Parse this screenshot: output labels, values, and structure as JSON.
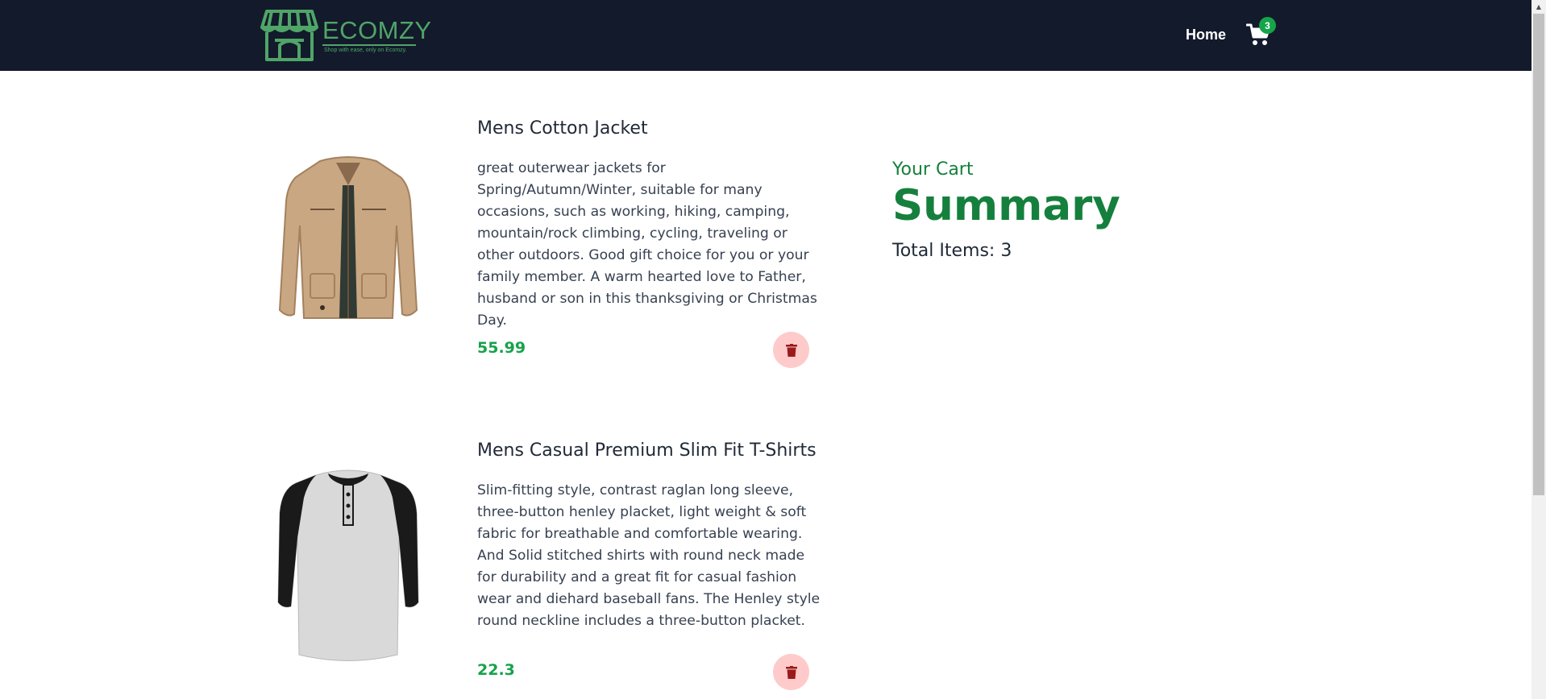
{
  "navbar": {
    "brand_name": "ECOMZY",
    "brand_tagline": "Shop with ease, only on Ecomzy.",
    "home_label": "Home",
    "cart_count": "3",
    "colors": {
      "background": "#131a2b",
      "brand": "#4fa568",
      "badge": "#16a34a"
    }
  },
  "items": [
    {
      "title": "Mens Cotton Jacket",
      "description": "great outerwear jackets for Spring/Autumn/Winter, suitable for many occasions, such as working, hiking, camping, mountain/rock climbing, cycling, traveling or other outdoors. Good gift choice for you or your family member. A warm hearted love to Father, husband or son in this thanksgiving or Christmas Day.",
      "price": "55.99",
      "image_icon": "jacket-image",
      "delete_icon": "trash-icon"
    },
    {
      "title": "Mens Casual Premium Slim Fit T-Shirts",
      "description": "Slim-fitting style, contrast raglan long sleeve, three-button henley placket, light weight & soft fabric for breathable and comfortable wearing. And Solid stitched shirts with round neck made for durability and a great fit for casual fashion wear and diehard baseball fans. The Henley style round neckline includes a three-button placket.",
      "price": "22.3",
      "image_icon": "tshirt-image",
      "delete_icon": "trash-icon"
    }
  ],
  "summary": {
    "heading": "Your Cart",
    "title": "Summary",
    "total_items": "Total Items: 3",
    "color": "#15803d"
  }
}
